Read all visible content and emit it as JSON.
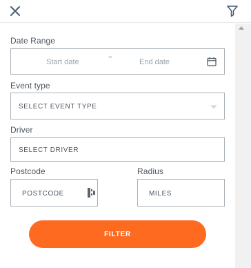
{
  "header": {
    "close_icon": "close-x-icon",
    "filter_icon": "funnel-icon"
  },
  "form": {
    "date_range": {
      "label": "Date Range",
      "start_placeholder": "Start date",
      "separator": "~",
      "end_placeholder": "End date",
      "icon": "calendar-icon"
    },
    "event_type": {
      "label": "Event type",
      "placeholder": "SELECT EVENT TYPE",
      "icon": "chevron-down-icon"
    },
    "driver": {
      "label": "Driver",
      "placeholder": "SELECT DRIVER"
    },
    "postcode": {
      "label": "Postcode",
      "placeholder": "POSTCODE",
      "icon": "autofill-icon"
    },
    "radius": {
      "label": "Radius",
      "placeholder": "MILES"
    },
    "submit_label": "FILTER"
  },
  "colors": {
    "accent": "#ff6a21",
    "border": "#a9b0b7",
    "text": "#4d5661"
  }
}
